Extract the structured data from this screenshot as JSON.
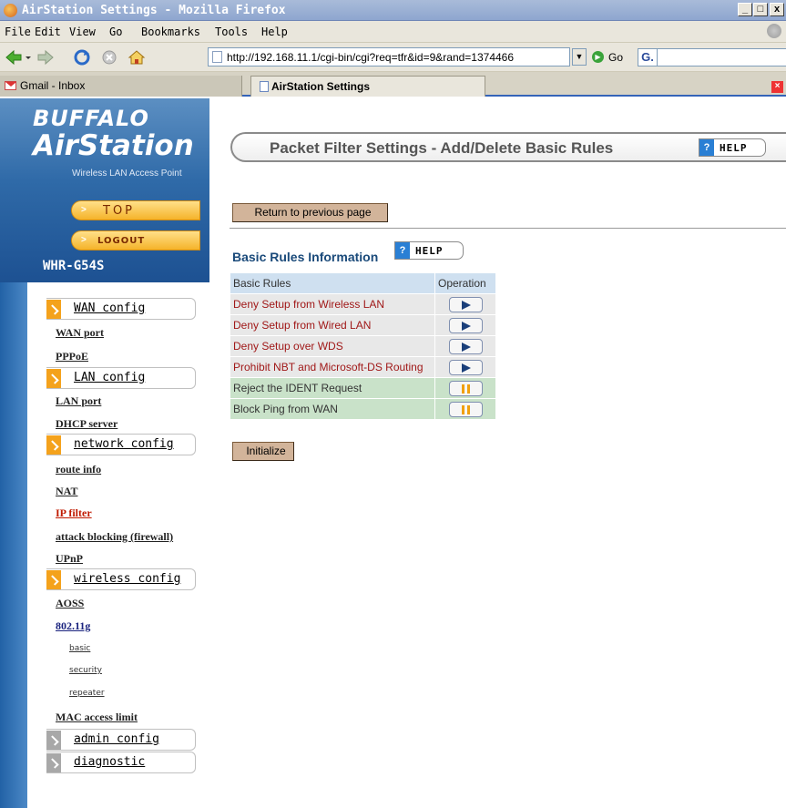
{
  "window": {
    "title": "AirStation Settings - Mozilla Firefox",
    "minimize": "_",
    "maximize": "□",
    "close": "x"
  },
  "menu": [
    "File",
    "Edit",
    "View",
    "Go",
    "Bookmarks",
    "Tools",
    "Help"
  ],
  "navbar": {
    "url": "http://192.168.11.1/cgi-bin/cgi?req=tfr&id=9&rand=1374466",
    "go_label": "Go",
    "search_engine_glyph": "G."
  },
  "tabs": [
    {
      "label": "Gmail - Inbox",
      "active": false
    },
    {
      "label": "AirStation Settings",
      "active": true
    }
  ],
  "sidebar": {
    "brand": "BUFFALO",
    "product": "AirStation",
    "tagline": "Wireless LAN Access Point",
    "top_label": "TOP",
    "logout_label": "LOGOUT",
    "model": "WHR-G54S",
    "sections": {
      "wan": "WAN config",
      "lan": "LAN config",
      "network": "network config",
      "wireless": "wireless config",
      "admin": "admin config",
      "diagnostic": "diagnostic"
    },
    "links": {
      "wan_port": "WAN port",
      "pppoe": "PPPoE",
      "lan_port": "LAN port",
      "dhcp_server": "DHCP server",
      "route_info": "route info",
      "nat": "NAT",
      "ip_filter": "IP filter",
      "attack_blocking": "attack blocking (firewall)",
      "upnp": "UPnP",
      "aoss": "AOSS",
      "dot11g": "802.11g",
      "basic": "basic",
      "security": "security",
      "repeater": "repeater",
      "mac_access_limit": "MAC access limit"
    }
  },
  "main": {
    "title": "Packet Filter Settings - Add/Delete Basic Rules",
    "help_label": "HELP",
    "help_glyph": "?",
    "return_label": "Return to previous page",
    "rules_title": "Basic Rules Information",
    "table": {
      "headers": [
        "Basic Rules",
        "Operation"
      ],
      "rows": [
        {
          "rule": "Deny Setup from Wireless LAN",
          "state": "deny",
          "operation_icon": "play-icon"
        },
        {
          "rule": "Deny Setup from Wired LAN",
          "state": "deny",
          "operation_icon": "play-icon"
        },
        {
          "rule": "Deny Setup over WDS",
          "state": "deny",
          "operation_icon": "play-icon"
        },
        {
          "rule": "Prohibit NBT and Microsoft-DS Routing",
          "state": "deny",
          "operation_icon": "play-icon"
        },
        {
          "rule": "Reject the IDENT Request",
          "state": "allow",
          "operation_icon": "pause-icon"
        },
        {
          "rule": "Block Ping from WAN",
          "state": "allow",
          "operation_icon": "pause-icon"
        }
      ]
    },
    "initialize_label": "Initialize"
  },
  "colors": {
    "titlebar": "#8ea6cf",
    "chrome": "#e9e6dc",
    "sidebar_blue": "#2f6aa8",
    "accent_orange": "#f4a21c",
    "deny_text": "#a01818",
    "allow_row": "#c9e2c9",
    "button_tan": "#d2b49a"
  }
}
